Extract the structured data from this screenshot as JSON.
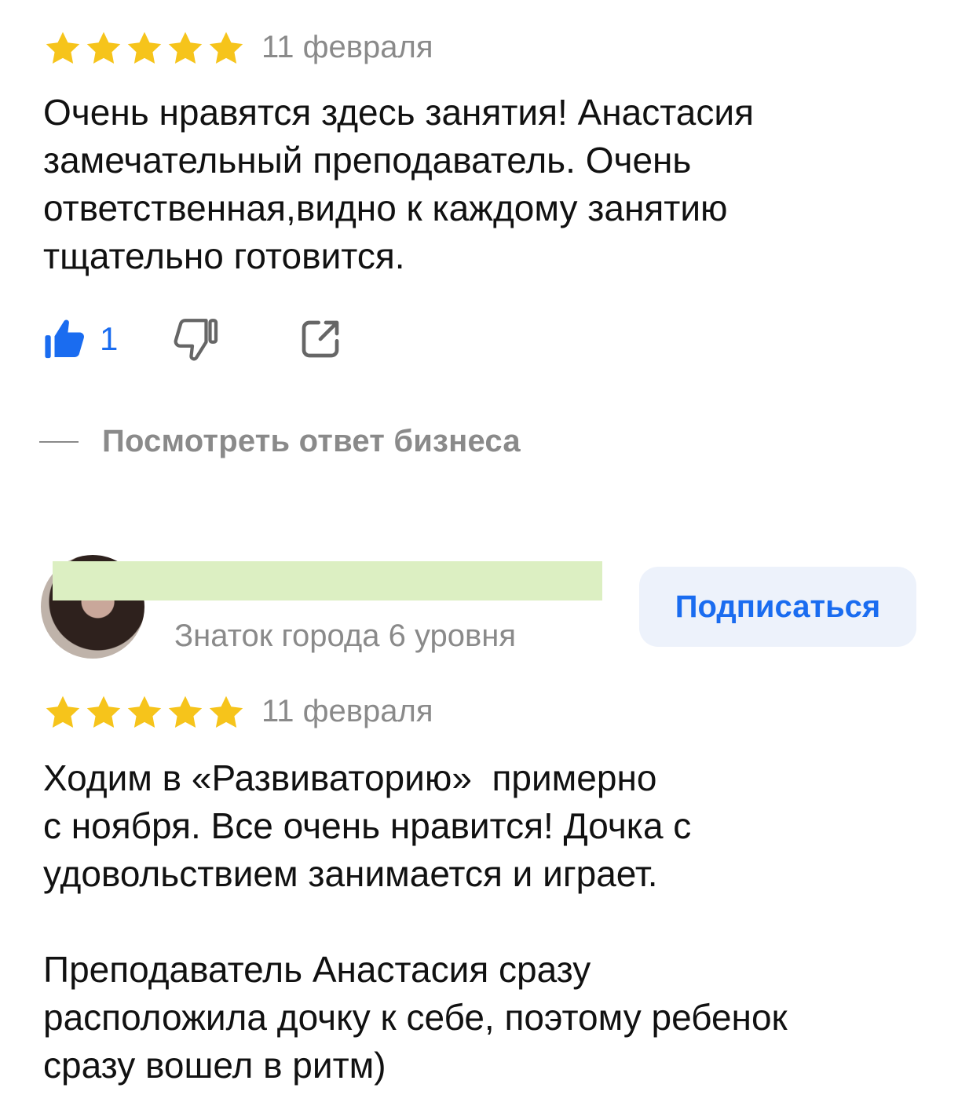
{
  "reviews": [
    {
      "rating": 5,
      "date": "11 февраля",
      "text": "Очень нравятся здесь занятия! Анастасия\nзамечательный преподаватель. Очень\nответственная,видно к каждому занятию\nтщательно готовится.",
      "likes": "1",
      "business_reply_label": "Посмотреть ответ бизнеса"
    },
    {
      "author_level": "Знаток города 6 уровня",
      "subscribe_label": "Подписаться",
      "rating": 5,
      "date": "11 февраля",
      "text": "Ходим в «Развиваторию»  примерно\nс ноября. Все очень нравится! Дочка с\nудовольствием занимается и играет.\n\nПреподаватель Анастасия сразу\nрасположила дочку к себе, поэтому ребенок\nсразу вошел в ритм)"
    }
  ],
  "colors": {
    "star": "#f6c41b",
    "accent": "#1a6cf0",
    "muted": "#8a8a8a",
    "redaction": "#dcefc2"
  },
  "icons": {
    "like": "thumbs-up-icon",
    "dislike": "thumbs-down-icon",
    "share": "share-icon",
    "star": "star-icon"
  }
}
